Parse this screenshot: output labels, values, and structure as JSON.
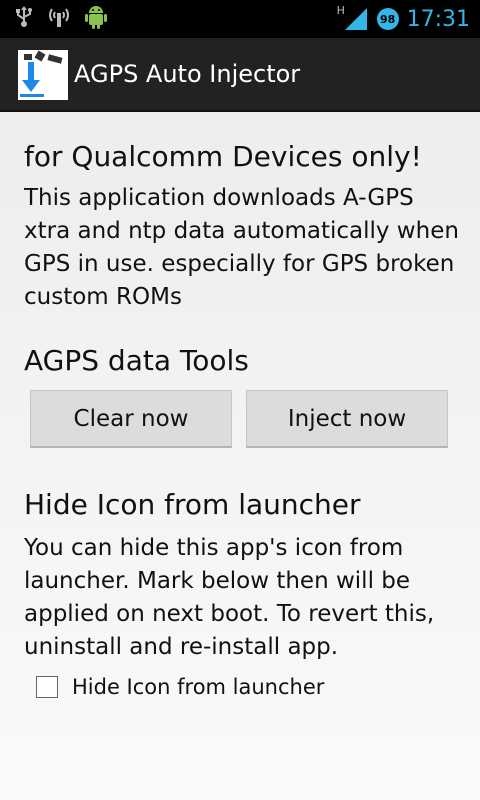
{
  "status_bar": {
    "time": "17:31",
    "badge_value": "98",
    "network_label": "H",
    "icons": [
      "usb-icon",
      "wifi-hotspot-icon",
      "android-debug-icon",
      "signal-icon",
      "battery-saver-icon"
    ],
    "accent_color": "#33b5e5"
  },
  "action_bar": {
    "title": "AGPS Auto Injector"
  },
  "main": {
    "section1_heading": "for Qualcomm Devices only!",
    "section1_body": "This application downloads A-GPS xtra and ntp data automatically when GPS in use. especially for GPS broken custom ROMs",
    "section2_heading": "AGPS data Tools",
    "clear_button": "Clear now",
    "inject_button": "Inject now",
    "section3_heading": "Hide Icon from launcher",
    "section3_body": "You can hide this app's icon from launcher. Mark below then will be applied on next boot. To revert this, uninstall and re-install app.",
    "checkbox_label": "Hide Icon from launcher",
    "checkbox_checked": false
  }
}
